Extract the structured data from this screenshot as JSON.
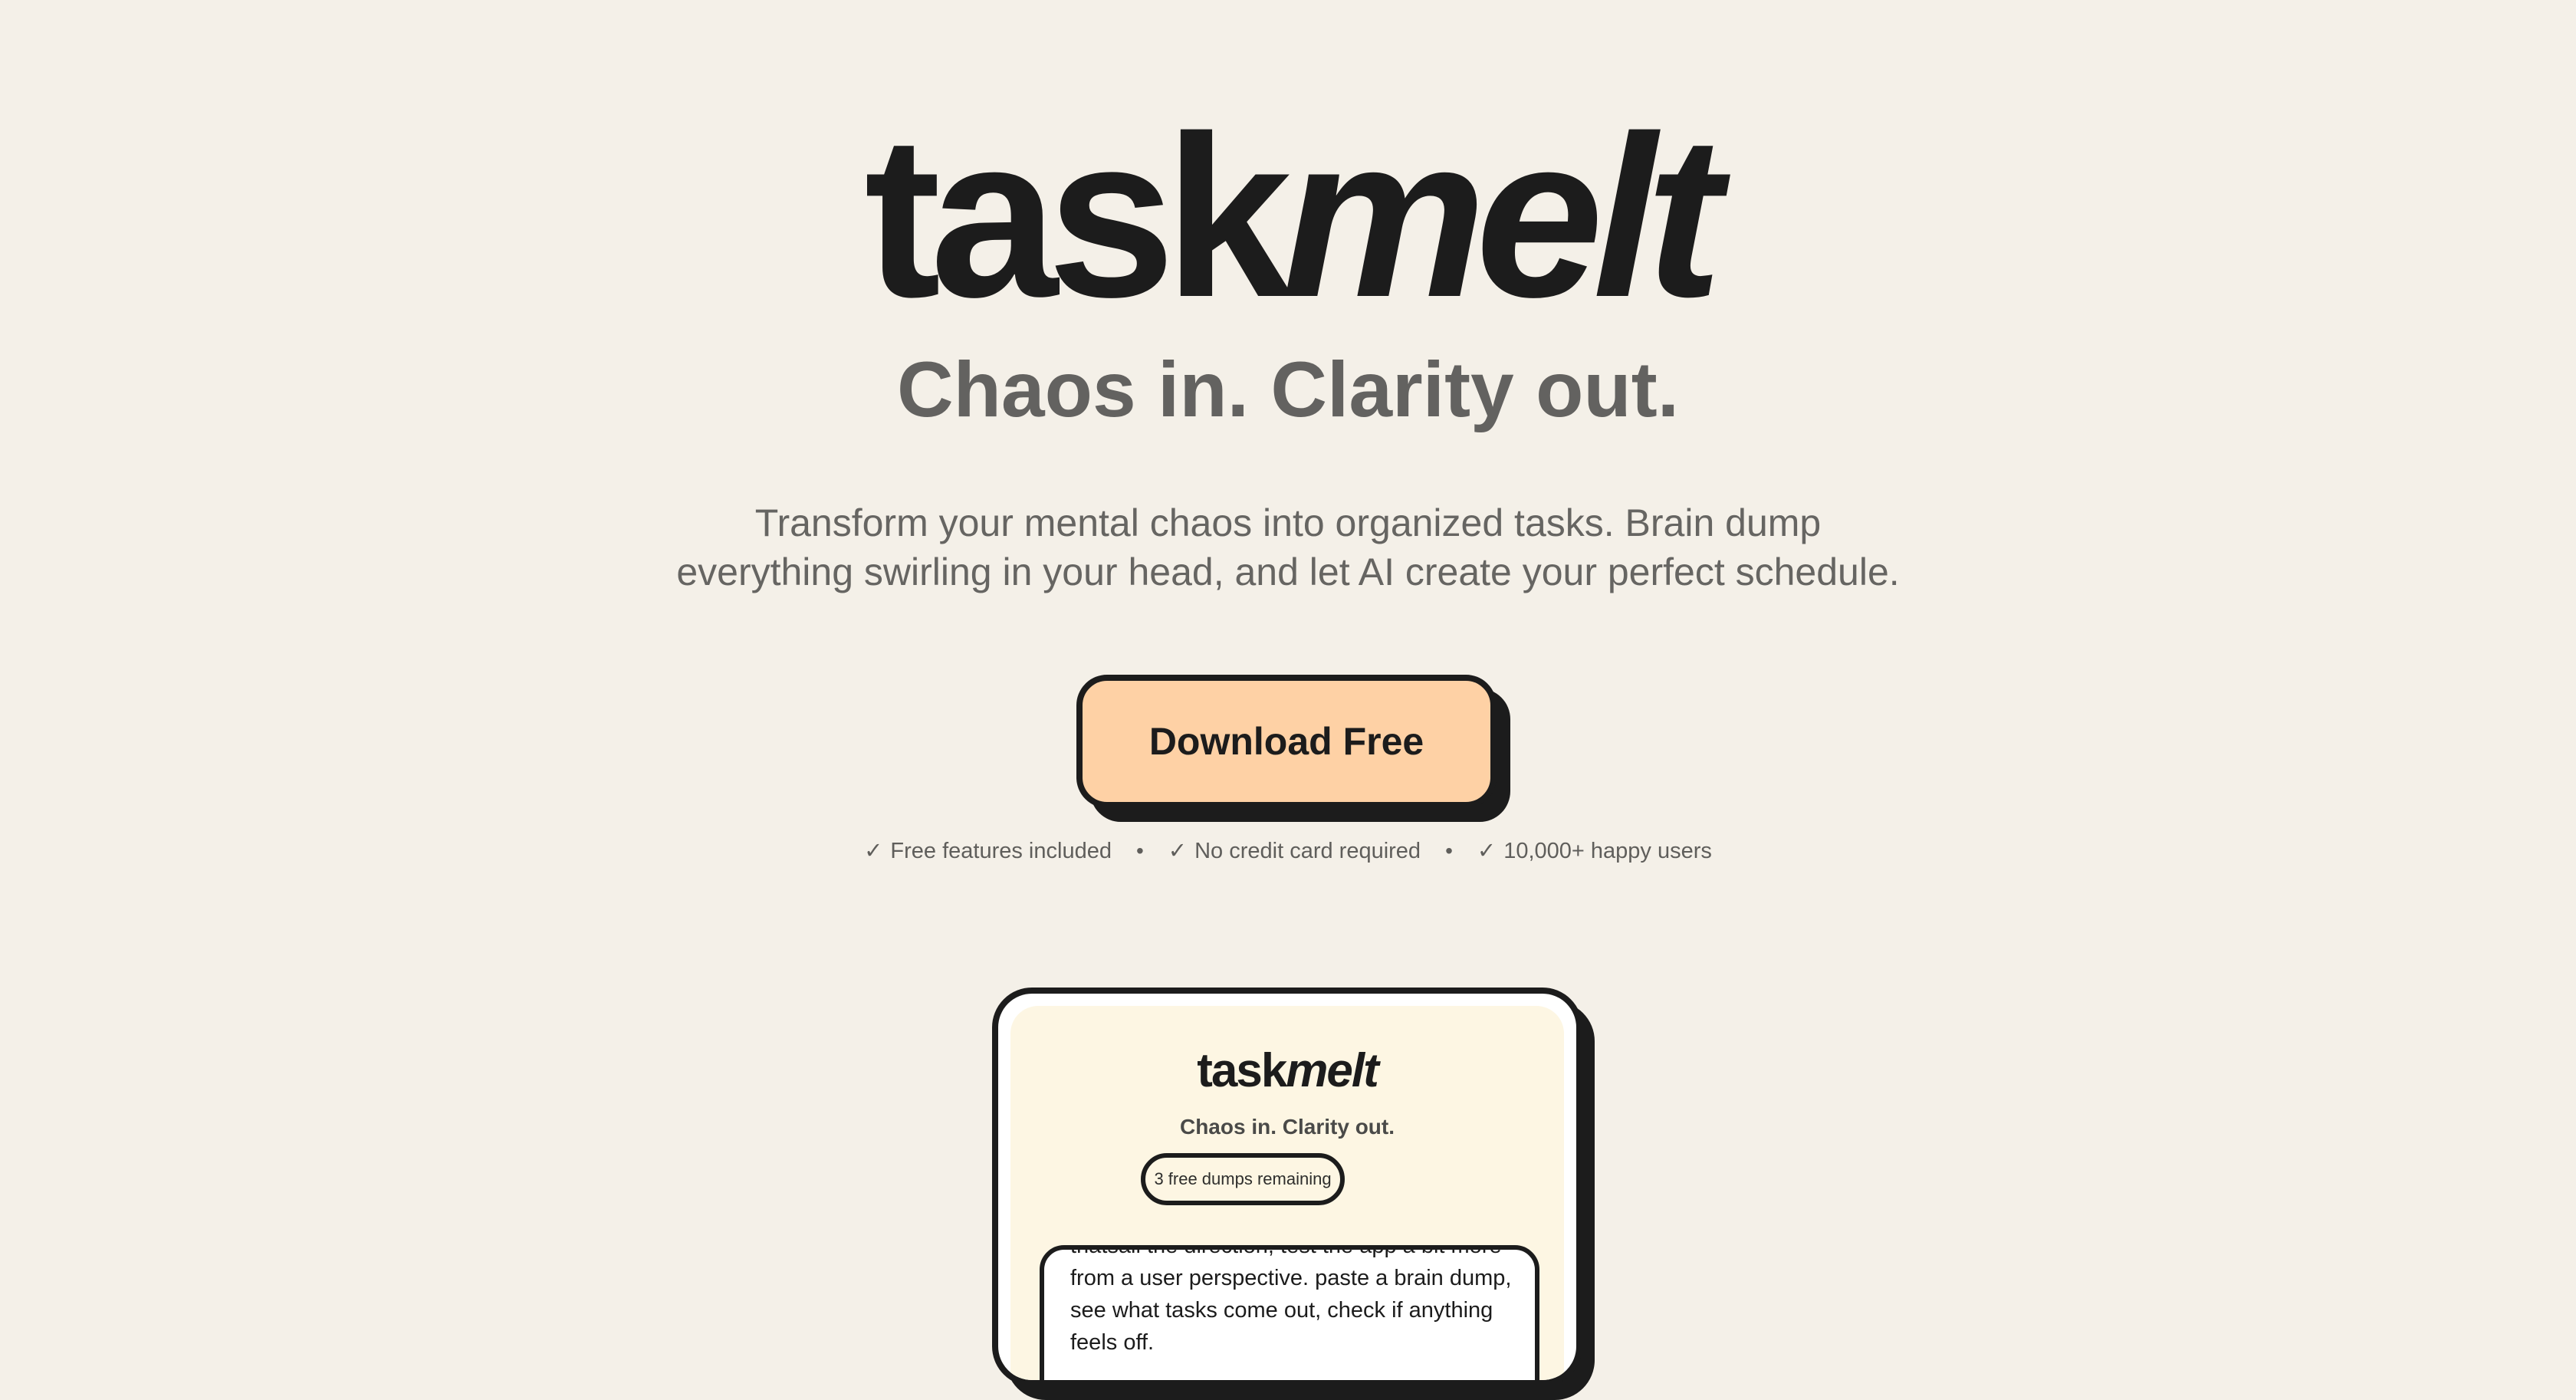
{
  "hero": {
    "logo_part1": "task",
    "logo_part2": "melt",
    "tagline": "Chaos in. Clarity out.",
    "description": "Transform your mental chaos into organized tasks. Brain dump everything swirling in your head, and let AI create your perfect schedule.",
    "cta_label": "Download Free",
    "perks": [
      "Free features included",
      "No credit card required",
      "10,000+ happy users"
    ],
    "check_glyph": "✓",
    "separator": "•"
  },
  "app_preview": {
    "logo_part1": "task",
    "logo_part2": "melt",
    "tagline": "Chaos in. Clarity out.",
    "badge": "3 free dumps remaining",
    "dump_text": "thatsall the direction, test the app a bit more from a user perspective. paste a brain dump, see what tasks come out, check if anything feels off."
  },
  "colors": {
    "background": "#f4f0e8",
    "ink": "#1c1c1c",
    "cta_fill": "#fed1a5",
    "app_screen": "#fdf6e3"
  }
}
